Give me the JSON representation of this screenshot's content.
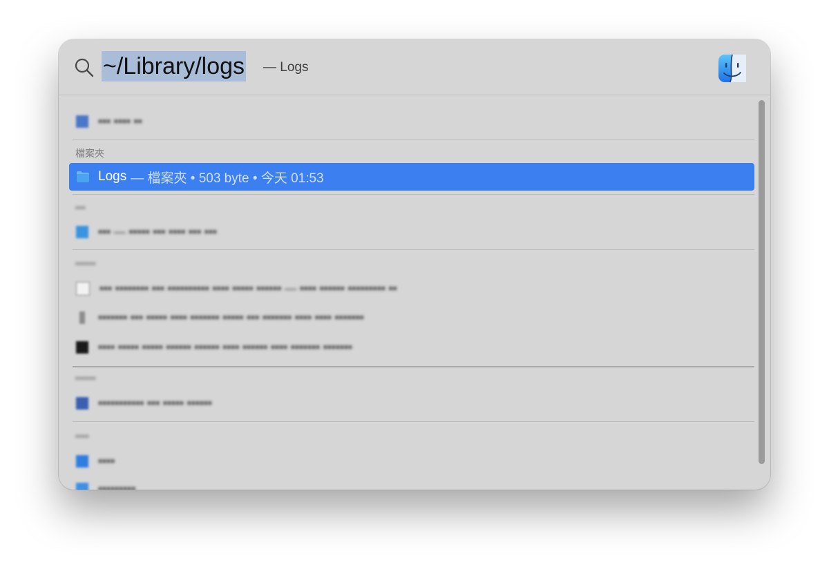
{
  "search": {
    "query": "~/Library/logs",
    "hint": "— Logs"
  },
  "sections": {
    "folders_header": "檔案夾"
  },
  "top_hit": {
    "title": "Logs",
    "meta": "— 檔案夾 • 503 byte • 今天 01:53"
  },
  "blurred": {
    "row_top": "▪▪▪ ▪▪▪▪ ▪▪",
    "header_2": "▪▪▪",
    "row_2": "▪▪▪ — ▪▪▪▪▪ ▪▪▪ ▪▪▪▪ ▪▪▪ ▪▪▪",
    "header_3": "▪▪▪▪▪▪",
    "row_3a": "▪▪▪ ▪▪▪▪▪▪▪▪ ▪▪▪ ▪▪▪▪▪▪▪▪▪▪ ▪▪▪▪ ▪▪▪▪▪ ▪▪▪▪▪▪ — ▪▪▪▪ ▪▪▪▪▪▪ ▪▪▪▪▪▪▪▪▪ ▪▪",
    "row_3b": "▪▪▪▪▪▪▪ ▪▪▪ ▪▪▪▪▪ ▪▪▪▪ ▪▪▪▪▪▪▪ ▪▪▪▪▪ ▪▪▪ ▪▪▪▪▪▪▪ ▪▪▪▪ ▪▪▪▪ ▪▪▪▪▪▪▪",
    "row_3c": "▪▪▪▪ ▪▪▪▪▪ ▪▪▪▪▪ ▪▪▪▪▪▪ ▪▪▪▪▪▪ ▪▪▪▪ ▪▪▪▪▪▪ ▪▪▪▪ ▪▪▪▪▪▪▪ ▪▪▪▪▪▪▪",
    "header_4": "▪▪▪▪▪▪",
    "row_4": "▪▪▪▪▪▪▪▪▪▪▪ ▪▪▪ ▪▪▪▪▪ ▪▪▪▪▪▪",
    "header_5": "▪▪▪▪",
    "row_5a": "▪▪▪▪",
    "row_5b": "▪▪▪▪▪▪▪▪▪"
  },
  "colors": {
    "selection": "#3b7ff0",
    "panel": "#d6d6d6",
    "query_highlight": "#a9bdd8"
  },
  "icons": {
    "search": "magnifier-icon",
    "finder": "finder-icon",
    "folder": "folder-icon"
  }
}
